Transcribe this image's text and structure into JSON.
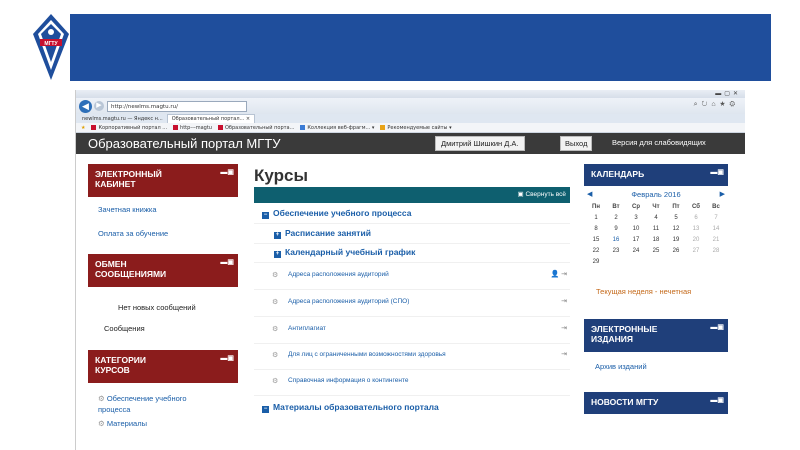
{
  "browser": {
    "url": "http://newlms.magtu.ru/",
    "tabs": [
      {
        "label": "newlms.magtu.ru — Яндекс н...",
        "active": false
      },
      {
        "label": "Образовательный портал... ×",
        "active": true
      }
    ],
    "favorites": [
      "Корпоративный портал ...",
      "http---magtu",
      "Образовательный порта...",
      "Коллекция веб-фрагм... ▾",
      "Рекомендуемые сайты ▾"
    ]
  },
  "navbar": {
    "site_title": "Образовательный портал МГТУ",
    "user_name": "Дмитрий Шишкин Д.А.",
    "logout": "Выход",
    "vision_version": "Версия для слабовидящих"
  },
  "left_blocks": {
    "cabinet": {
      "title_line1": "ЭЛЕКТРОННЫЙ",
      "title_line2": "КАБИНЕТ",
      "links": [
        "Зачетная книжка",
        "Оплата за обучение"
      ]
    },
    "messages": {
      "title_line1": "ОБМЕН",
      "title_line2": "СООБЩЕНИЯМИ",
      "empty": "Нет новых сообщений",
      "link": "Сообщения"
    },
    "categories": {
      "title_line1": "КАТЕГОРИИ",
      "title_line2": "КУРСОВ",
      "items": [
        "Обеспечение учебного",
        "процесса",
        "Материалы"
      ]
    }
  },
  "main": {
    "title": "Курсы",
    "collapse_all": "Свернуть всё",
    "category_1": "Обеспечение учебного процесса",
    "sub_1": "Расписание занятий",
    "sub_2": "Календарный учебный график",
    "courses": [
      "Адреса расположения аудиторий",
      "Адреса расположения аудиторий (СПО)",
      "Антиплагиат",
      "Для лиц с ограниченными возможностями здоровья",
      "Справочная информация о контингенте"
    ],
    "category_2": "Материалы образовательного портала"
  },
  "right_blocks": {
    "calendar": {
      "title": "КАЛЕНДАРЬ",
      "month": "Февраль 2016",
      "weekdays": [
        "Пн",
        "Вт",
        "Ср",
        "Чт",
        "Пт",
        "Сб",
        "Вс"
      ],
      "today": "16",
      "week_note": "Текущая неделя - нечетная"
    },
    "e_editions": {
      "title_line1": "ЭЛЕКТРОННЫЕ",
      "title_line2": "ИЗДАНИЯ",
      "link": "Архив изданий"
    },
    "news": {
      "title": "НОВОСТИ МГТУ"
    }
  },
  "colors": {
    "banner": "#1f4e9c",
    "red_block": "#8b1c1c",
    "blue_block": "#1f3f7a",
    "teal_bar": "#0e5f6f",
    "link": "#1a5ea8"
  }
}
